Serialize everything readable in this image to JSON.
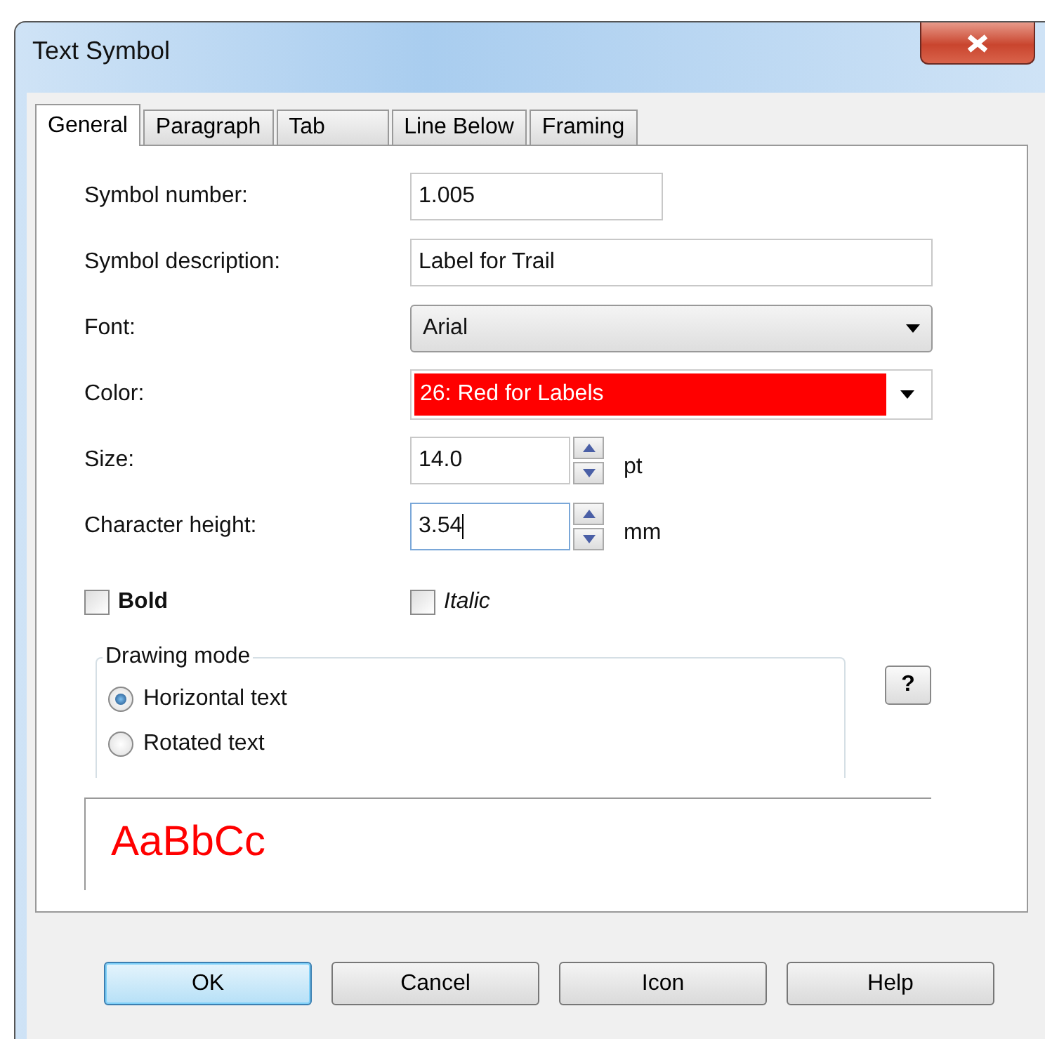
{
  "window": {
    "title": "Text Symbol"
  },
  "tabs": [
    {
      "label": "General",
      "selected": true
    },
    {
      "label": "Paragraph",
      "selected": false
    },
    {
      "label": "Tab",
      "selected": false
    },
    {
      "label": "Line Below",
      "selected": false
    },
    {
      "label": "Framing",
      "selected": false
    }
  ],
  "rows": [
    {
      "kind": "text",
      "label": "Symbol number:",
      "value": "1.005",
      "focused": false
    },
    {
      "kind": "text",
      "label": "Symbol description:",
      "value": "Label for Trail",
      "focused": false
    },
    {
      "kind": "dropdown",
      "label": "Font:",
      "value": "Arial"
    },
    {
      "kind": "color",
      "label": "Color:",
      "value": "26: Red for Labels",
      "color": "#ff0000"
    },
    {
      "kind": "spinner",
      "label": "Size:",
      "value": "14.0",
      "unit": "pt",
      "focused": false
    },
    {
      "kind": "spinner",
      "label": "Character height:",
      "value": "3.54",
      "unit": "mm",
      "focused": true
    }
  ],
  "checkboxes": [
    {
      "label": "Bold",
      "kind": "bold",
      "checked": false
    },
    {
      "label": "Italic",
      "kind": "italic",
      "checked": false
    }
  ],
  "drawing_mode": {
    "title": "Drawing mode",
    "options": [
      {
        "label": "Horizontal text",
        "selected": true
      },
      {
        "label": "Rotated text",
        "selected": false
      }
    ]
  },
  "help_button": "?",
  "preview": {
    "text": "AaBbCc"
  },
  "buttons": [
    {
      "label": "OK",
      "default": true
    },
    {
      "label": "Cancel",
      "default": false
    },
    {
      "label": "Icon",
      "default": false
    },
    {
      "label": "Help",
      "default": false
    }
  ]
}
